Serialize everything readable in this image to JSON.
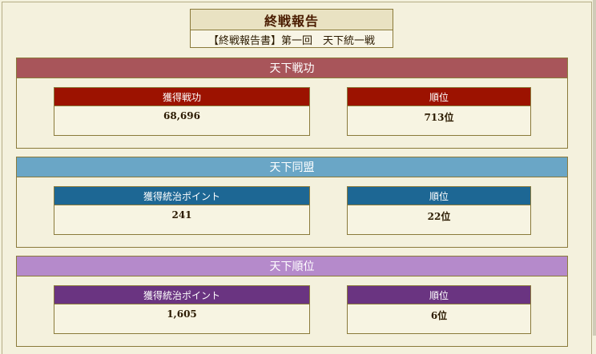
{
  "page": {
    "title": "終戦報告",
    "subtitle": "【終戦報告書】第一回　天下統一戦"
  },
  "sections": [
    {
      "heading": "天下戦功",
      "header_color": "#a8555a",
      "card_color": "#9c1200",
      "left": {
        "label": "獲得戦功",
        "value": "68,696"
      },
      "right": {
        "label": "順位",
        "value": "713位"
      }
    },
    {
      "heading": "天下同盟",
      "header_color": "#6aa6c6",
      "card_color": "#1d6794",
      "left": {
        "label": "獲得統治ポイント",
        "value": "241"
      },
      "right": {
        "label": "順位",
        "value": "22位"
      }
    },
    {
      "heading": "天下順位",
      "header_color": "#b58acb",
      "card_color": "#6a3481",
      "left": {
        "label": "獲得統治ポイント",
        "value": "1,605"
      },
      "right": {
        "label": "順位",
        "value": "6位"
      }
    }
  ]
}
